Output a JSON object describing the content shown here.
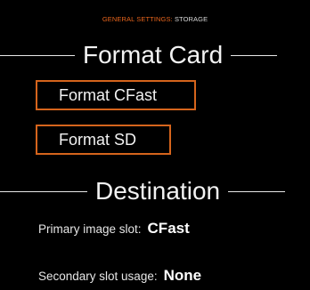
{
  "breadcrumb": {
    "section": "GENERAL SETTINGS:",
    "current": "STORAGE"
  },
  "format_card": {
    "title": "Format Card",
    "buttons": {
      "cfast": "Format CFast",
      "sd": "Format SD"
    }
  },
  "destination": {
    "title": "Destination",
    "primary": {
      "label": "Primary image slot:",
      "value": "CFast"
    },
    "secondary": {
      "label": "Secondary slot usage:",
      "value": "None"
    }
  },
  "colors": {
    "accent": "#e8651c",
    "button_border": "#d5641c",
    "background": "#000000",
    "text": "#f2f2f2"
  }
}
